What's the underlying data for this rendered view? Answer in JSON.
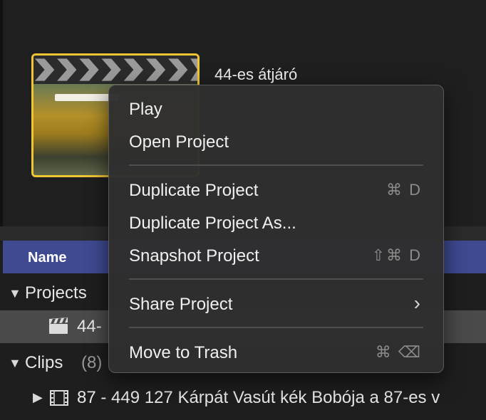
{
  "browser": {
    "project_title": "44-es átjáró",
    "column_header": "Name",
    "projects_label": "Projects",
    "project_item": "44-",
    "clips_label": "Clips",
    "clips_count": "(8)",
    "clip_item": "87 - 449 127 Kárpát Vasút kék Bobója a 87-es v"
  },
  "context_menu": {
    "play": "Play",
    "open_project": "Open Project",
    "duplicate_project": "Duplicate Project",
    "duplicate_shortcut": "⌘ D",
    "duplicate_project_as": "Duplicate Project As...",
    "snapshot_project": "Snapshot Project",
    "snapshot_shortcut": "⇧⌘ D",
    "share_project": "Share Project",
    "share_arrow": "›",
    "move_to_trash": "Move to Trash",
    "trash_shortcut": "⌘ ⌫"
  },
  "colors": {
    "selection_border": "#f0c534",
    "header_bg": "#3f4a91",
    "menu_bg": "#2e2e2e"
  }
}
